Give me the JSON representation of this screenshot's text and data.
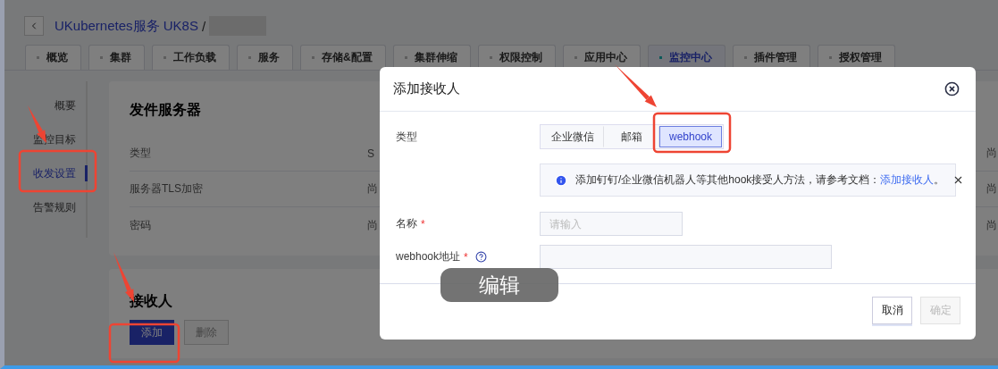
{
  "header": {
    "breadcrumb": "UKubernetes服务 UK8S",
    "separator": "/"
  },
  "tabs": [
    {
      "label": "概览",
      "selected": false
    },
    {
      "label": "集群",
      "selected": false
    },
    {
      "label": "工作负载",
      "selected": false
    },
    {
      "label": "服务",
      "selected": false
    },
    {
      "label": "存储&配置",
      "selected": false
    },
    {
      "label": "集群伸缩",
      "selected": false
    },
    {
      "label": "权限控制",
      "selected": false
    },
    {
      "label": "应用中心",
      "selected": false
    },
    {
      "label": "监控中心",
      "selected": true
    },
    {
      "label": "插件管理",
      "selected": false
    },
    {
      "label": "授权管理",
      "selected": false
    }
  ],
  "sidenav": [
    {
      "label": "概要",
      "selected": false
    },
    {
      "label": "监控目标",
      "selected": false
    },
    {
      "label": "收发设置",
      "selected": true
    },
    {
      "label": "告警规则",
      "selected": false
    }
  ],
  "server_card": {
    "title": "发件服务器",
    "rows": [
      {
        "label": "类型",
        "value": "S",
        "extra": "尚"
      },
      {
        "label": "服务器TLS加密",
        "value": "尚",
        "extra": "尚"
      },
      {
        "label": "密码",
        "value": "尚",
        "extra": "尚"
      }
    ]
  },
  "receiver_card": {
    "title": "接收人",
    "buttons": [
      {
        "label": "添加",
        "kind": "primary",
        "disabled": false
      },
      {
        "label": "删除",
        "kind": "default",
        "disabled": true
      }
    ]
  },
  "dialog": {
    "title": "添加接收人",
    "type_label": "类型",
    "type_options": [
      {
        "label": "企业微信",
        "selected": false
      },
      {
        "label": "邮箱",
        "selected": false
      },
      {
        "label": "webhook",
        "selected": true
      }
    ],
    "alert": {
      "text": "添加钉钉/企业微信机器人等其他hook接受人方法，请参考文档：",
      "link": "添加接收人",
      "end": "。"
    },
    "required_mark": "*",
    "fields": [
      {
        "label": "名称",
        "required": true,
        "help": false,
        "placeholder": "请输入"
      },
      {
        "label": "webhook地址",
        "required": true,
        "help": true
      }
    ],
    "buttons": [
      {
        "label": "取消",
        "disabled": false
      },
      {
        "label": "确定",
        "disabled": true
      }
    ]
  },
  "tooltip": "编辑"
}
